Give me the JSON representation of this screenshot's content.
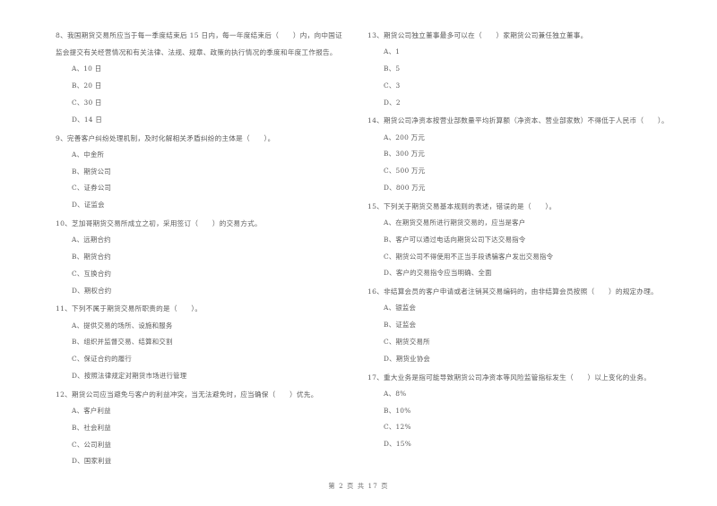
{
  "document": {
    "background_color": "#ffffff",
    "text_color": "#5a5a5a",
    "footer": {
      "page_label": "第 2 页  共 17 页"
    }
  },
  "columns": [
    {
      "side": "left",
      "questions": [
        {
          "number": "8",
          "stem": "8、我国期货交易所应当于每一季度结束后 15 日内，每一年度结束后（　　）内，向中国证监会提交有关经营情况和有关法律、法规、规章、政策的执行情况的季度和年度工作报告。",
          "options": [
            "A、10 日",
            "B、20 日",
            "C、30 日",
            "D、14 日"
          ]
        },
        {
          "number": "9",
          "stem": "9、完善客户纠纷处理机制，及时化解相关矛盾纠纷的主体是（　　）。",
          "options": [
            "A、中金所",
            "B、期货公司",
            "C、证券公司",
            "D、证监会"
          ]
        },
        {
          "number": "10",
          "stem": "10、芝加哥期货交易所成立之初，采用签订（　　）的交易方式。",
          "options": [
            "A、远期合约",
            "B、期货合约",
            "C、互换合约",
            "D、期权合约"
          ]
        },
        {
          "number": "11",
          "stem": "11、下列不属于期货交易所职责的是（　　）。",
          "options": [
            "A、提供交易的场所、设施和服务",
            "B、组织并监督交易、结算和交割",
            "C、保证合约的履行",
            "D、按照法律规定对期货市场进行管理"
          ]
        },
        {
          "number": "12",
          "stem": "12、期货公司应当避免与客户的利益冲突，当无法避免时，应当确保（　　）优先。",
          "options": [
            "A、客户利益",
            "B、社会利益",
            "C、公司利益",
            "D、国家利益"
          ]
        }
      ]
    },
    {
      "side": "right",
      "questions": [
        {
          "number": "13",
          "stem": "13、期货公司独立董事最多可以在（　　）家期货公司兼任独立董事。",
          "options": [
            "A、1",
            "B、5",
            "C、3",
            "D、2"
          ]
        },
        {
          "number": "14",
          "stem": "14、期货公司净资本按营业部数量平均折算额（净资本、营业部家数）不得低于人民币（　　）。",
          "options": [
            "A、200 万元",
            "B、300 万元",
            "C、500 万元",
            "D、800 万元"
          ]
        },
        {
          "number": "15",
          "stem": "15、下列关于期货交易基本规则的表述，错误的是（　　）。",
          "options": [
            "A、在期货交易所进行期货交易的，应当是客户",
            "B、客户可以通过电话向期货公司下达交易指令",
            "C、期货公司不得使用不正当手段诱骗客户发出交易指令",
            "D、客户的交易指令应当明确、全面"
          ]
        },
        {
          "number": "16",
          "stem": "16、非结算会员的客户申请或者注销其交易编码的，由非结算会员按照（　　）的规定办理。",
          "options": [
            "A、银监会",
            "B、证监会",
            "C、期货交易所",
            "D、期货业协会"
          ]
        },
        {
          "number": "17",
          "stem": "17、重大业务是指可能导致期货公司净资本等风险监管指标发生（　　）以上变化的业务。",
          "options": [
            "A、8%",
            "B、10%",
            "C、12%",
            "D、15%"
          ]
        }
      ]
    }
  ]
}
